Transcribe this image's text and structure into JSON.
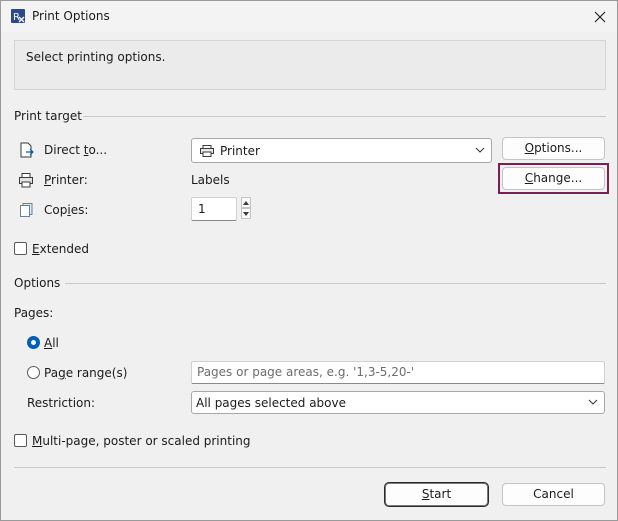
{
  "window": {
    "title": "Print Options"
  },
  "info": {
    "text": "Select printing options."
  },
  "print_target": {
    "section_label": "Print target",
    "direct_to": {
      "label_pre": "Direct ",
      "label_key": "t",
      "label_post": "o...",
      "value": "Printer"
    },
    "printer": {
      "label_pre": "",
      "label_key": "P",
      "label_post": "rinter:",
      "value": "Labels"
    },
    "copies": {
      "label_pre": "Cop",
      "label_key": "i",
      "label_post": "es:",
      "value": "1"
    },
    "options_button": {
      "pre": "",
      "key": "O",
      "post": "ptions..."
    },
    "change_button": {
      "pre": "",
      "key": "C",
      "post": "hange..."
    },
    "extended": {
      "pre": "",
      "key": "E",
      "post": "xtended",
      "checked": false
    }
  },
  "options": {
    "section_label": "Options",
    "pages_label": "Pages:",
    "all": {
      "pre": "",
      "key": "A",
      "post": "ll",
      "selected": true
    },
    "page_range": {
      "pre": "Pa",
      "key": "g",
      "post": "e range(s)",
      "selected": false,
      "placeholder": "Pages or page areas, e.g. '1,3-5,20-'"
    },
    "restriction": {
      "pre": "Restriction",
      "key": "",
      "post": ":",
      "value": "All pages selected above"
    },
    "multipage": {
      "pre": "",
      "key": "M",
      "post": "ulti-page, poster or scaled printing",
      "checked": false
    }
  },
  "footer": {
    "start_button": {
      "pre": "",
      "key": "S",
      "post": "tart"
    },
    "cancel_button": "Cancel"
  },
  "colors": {
    "highlight_border": "#7a1f4f",
    "accent": "#005fb8"
  },
  "icons": {
    "app": "app-print-icon",
    "close": "close-icon",
    "direct": "document-export-icon",
    "printer": "printer-icon",
    "copies": "copies-icon",
    "chevron": "chevron-down-icon"
  }
}
